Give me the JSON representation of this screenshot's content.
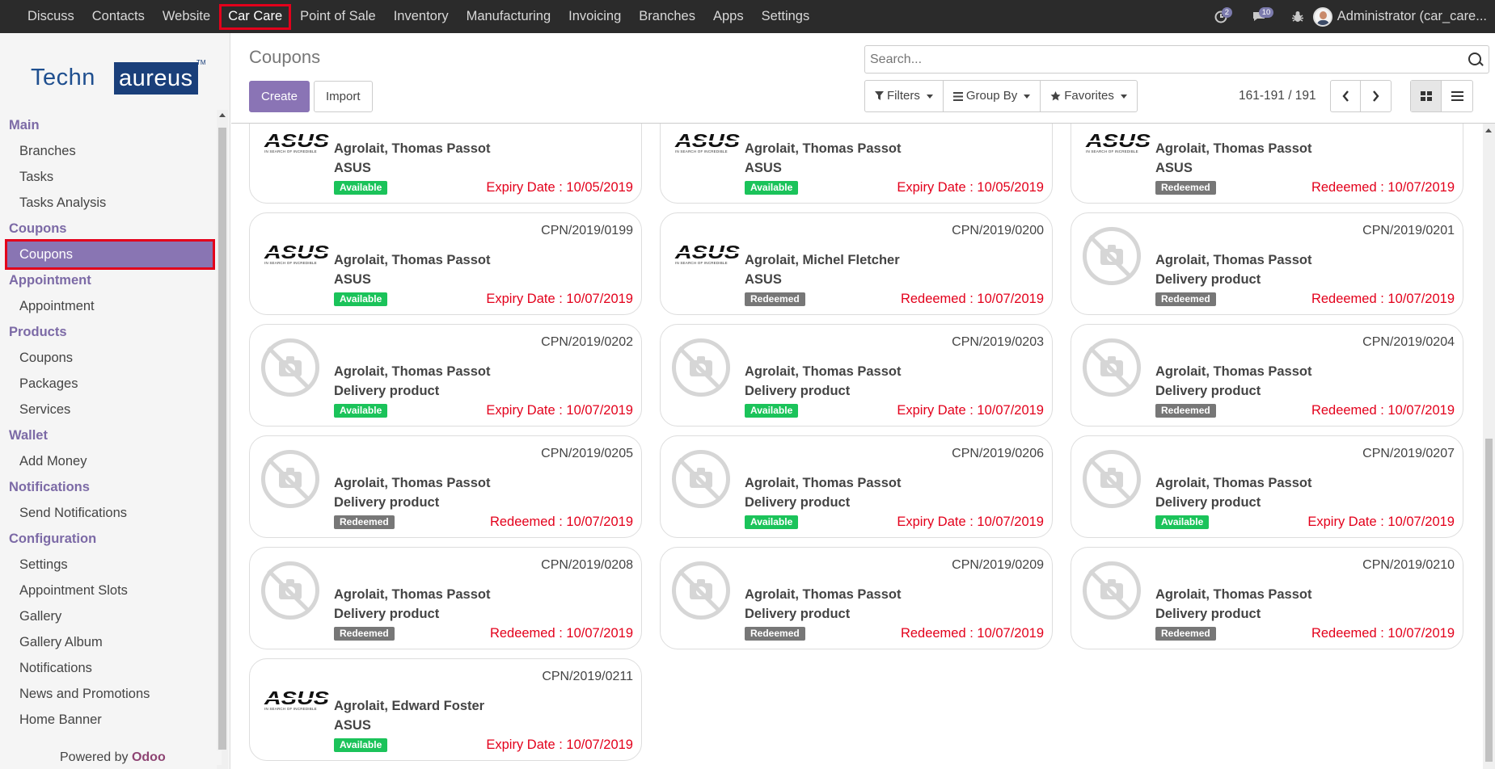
{
  "navbar": {
    "items": [
      "Discuss",
      "Contacts",
      "Website",
      "Car Care",
      "Point of Sale",
      "Inventory",
      "Manufacturing",
      "Invoicing",
      "Branches",
      "Apps",
      "Settings"
    ],
    "active": "Car Care",
    "activities_count": "2",
    "messages_count": "10",
    "user": "Administrator (car_care..."
  },
  "sidebar": {
    "logo_text_1": "Techn",
    "logo_text_2": "aureus",
    "logo_tm": "TM",
    "sections": [
      {
        "title": "Main",
        "items": [
          "Branches",
          "Tasks",
          "Tasks Analysis"
        ]
      },
      {
        "title": "Coupons",
        "items": [
          "Coupons"
        ]
      },
      {
        "title": "Appointment",
        "items": [
          "Appointment"
        ]
      },
      {
        "title": "Products",
        "items": [
          "Coupons",
          "Packages",
          "Services"
        ]
      },
      {
        "title": "Wallet",
        "items": [
          "Add Money"
        ]
      },
      {
        "title": "Notifications",
        "items": [
          "Send Notifications"
        ]
      },
      {
        "title": "Configuration",
        "items": [
          "Settings",
          "Appointment Slots",
          "Gallery",
          "Gallery Album",
          "Notifications",
          "News and Promotions",
          "Home Banner"
        ]
      }
    ],
    "powered_by": "Powered by",
    "powered_brand": "Odoo"
  },
  "control_panel": {
    "title": "Coupons",
    "create_label": "Create",
    "import_label": "Import",
    "search_placeholder": "Search...",
    "filters_label": "Filters",
    "group_by_label": "Group By",
    "favorites_label": "Favorites",
    "pager": "161-191 / 191"
  },
  "cards": [
    {
      "ref": "",
      "name": "Agrolait, Thomas Passot",
      "product": "ASUS",
      "image": "asus",
      "status": "Available",
      "date": "Expiry Date : 10/05/2019"
    },
    {
      "ref": "",
      "name": "Agrolait, Thomas Passot",
      "product": "ASUS",
      "image": "asus",
      "status": "Available",
      "date": "Expiry Date : 10/05/2019"
    },
    {
      "ref": "",
      "name": "Agrolait, Thomas Passot",
      "product": "ASUS",
      "image": "asus",
      "status": "Redeemed",
      "date": "Redeemed : 10/07/2019"
    },
    {
      "ref": "CPN/2019/0199",
      "name": "Agrolait, Thomas Passot",
      "product": "ASUS",
      "image": "asus",
      "status": "Available",
      "date": "Expiry Date : 10/07/2019"
    },
    {
      "ref": "CPN/2019/0200",
      "name": "Agrolait, Michel Fletcher",
      "product": "ASUS",
      "image": "asus",
      "status": "Redeemed",
      "date": "Redeemed : 10/07/2019"
    },
    {
      "ref": "CPN/2019/0201",
      "name": "Agrolait, Thomas Passot",
      "product": "Delivery product",
      "image": "none",
      "status": "Redeemed",
      "date": "Redeemed : 10/07/2019"
    },
    {
      "ref": "CPN/2019/0202",
      "name": "Agrolait, Thomas Passot",
      "product": "Delivery product",
      "image": "none",
      "status": "Available",
      "date": "Expiry Date : 10/07/2019"
    },
    {
      "ref": "CPN/2019/0203",
      "name": "Agrolait, Thomas Passot",
      "product": "Delivery product",
      "image": "none",
      "status": "Available",
      "date": "Expiry Date : 10/07/2019"
    },
    {
      "ref": "CPN/2019/0204",
      "name": "Agrolait, Thomas Passot",
      "product": "Delivery product",
      "image": "none",
      "status": "Redeemed",
      "date": "Redeemed : 10/07/2019"
    },
    {
      "ref": "CPN/2019/0205",
      "name": "Agrolait, Thomas Passot",
      "product": "Delivery product",
      "image": "none",
      "status": "Redeemed",
      "date": "Redeemed : 10/07/2019"
    },
    {
      "ref": "CPN/2019/0206",
      "name": "Agrolait, Thomas Passot",
      "product": "Delivery product",
      "image": "none",
      "status": "Available",
      "date": "Expiry Date : 10/07/2019"
    },
    {
      "ref": "CPN/2019/0207",
      "name": "Agrolait, Thomas Passot",
      "product": "Delivery product",
      "image": "none",
      "status": "Available",
      "date": "Expiry Date : 10/07/2019"
    },
    {
      "ref": "CPN/2019/0208",
      "name": "Agrolait, Thomas Passot",
      "product": "Delivery product",
      "image": "none",
      "status": "Redeemed",
      "date": "Redeemed : 10/07/2019"
    },
    {
      "ref": "CPN/2019/0209",
      "name": "Agrolait, Thomas Passot",
      "product": "Delivery product",
      "image": "none",
      "status": "Redeemed",
      "date": "Redeemed : 10/07/2019"
    },
    {
      "ref": "CPN/2019/0210",
      "name": "Agrolait, Thomas Passot",
      "product": "Delivery product",
      "image": "none",
      "status": "Redeemed",
      "date": "Redeemed : 10/07/2019"
    },
    {
      "ref": "CPN/2019/0211",
      "name": "Agrolait, Edward Foster",
      "product": "ASUS",
      "image": "asus",
      "status": "Available",
      "date": "Expiry Date : 10/07/2019"
    }
  ],
  "asus_logo": {
    "word": "ASUS",
    "tagline": "IN SEARCH OF INCREDIBLE"
  },
  "colors": {
    "accent": "#8a74b5",
    "available": "#1bc35a",
    "redeemed": "#777777",
    "date": "#e3001b",
    "highlight": "#e3001b"
  }
}
